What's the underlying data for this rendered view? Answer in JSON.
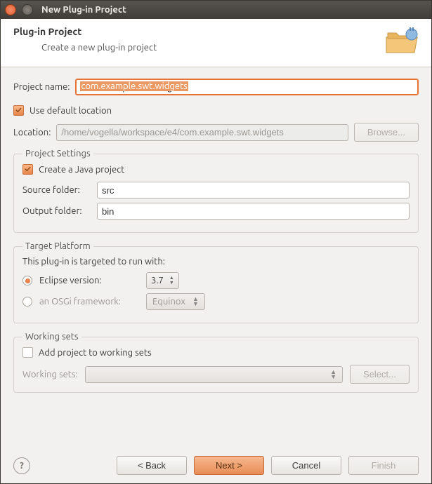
{
  "titlebar": {
    "title": "New Plug-in Project"
  },
  "banner": {
    "title": "Plug-in Project",
    "subtitle": "Create a new plug-in project"
  },
  "project_name": {
    "label": "Project name:",
    "value": "com.example.swt.widgets"
  },
  "use_default": {
    "label": "Use default location",
    "checked": true
  },
  "location": {
    "label": "Location:",
    "value": "/home/vogella/workspace/e4/com.example.swt.widgets",
    "browse": "Browse..."
  },
  "project_settings": {
    "legend": "Project Settings",
    "create_java": {
      "label": "Create a Java project",
      "checked": true
    },
    "source": {
      "label": "Source folder:",
      "value": "src"
    },
    "output": {
      "label": "Output folder:",
      "value": "bin"
    }
  },
  "target_platform": {
    "legend": "Target Platform",
    "desc": "This plug-in is targeted to run with:",
    "eclipse": {
      "label": "Eclipse version:",
      "value": "3.7",
      "selected": true
    },
    "osgi": {
      "label": "an OSGi framework:",
      "value": "Equinox",
      "selected": false
    }
  },
  "working_sets": {
    "legend": "Working sets",
    "add": {
      "label": "Add project to working sets",
      "checked": false
    },
    "label": "Working sets:",
    "select": "Select..."
  },
  "buttons": {
    "back": "< Back",
    "next": "Next >",
    "cancel": "Cancel",
    "finish": "Finish"
  },
  "icons": {
    "close": "close-icon",
    "minimize": "minimize-icon",
    "wizard": "folder-plug-icon",
    "help": "help-icon"
  }
}
